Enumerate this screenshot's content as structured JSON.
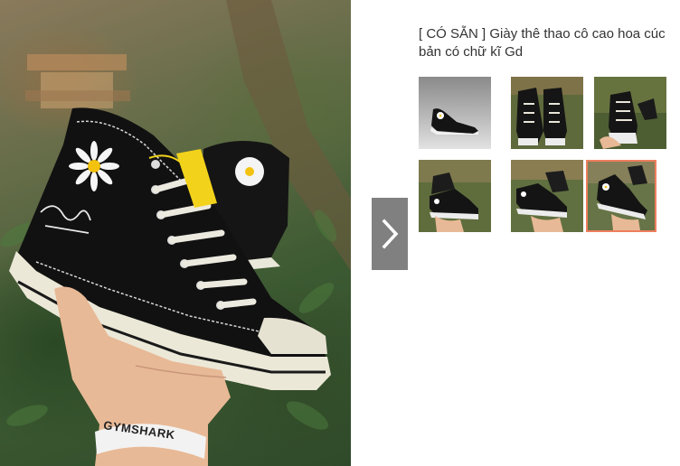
{
  "product": {
    "title": "[ CÓ SẴN ] Giày thê thao cô cao hoa cúc bản có chữ kĩ Gd",
    "main_image": {
      "description_icon": "sneaker-photo",
      "wristband_text": "GYMSHARK"
    }
  },
  "gallery": {
    "next_icon": "chevron-right-icon",
    "thumbnails": [
      {
        "icon": "sneaker-photo",
        "active": false
      },
      {
        "icon": "sneaker-photo",
        "active": false
      },
      {
        "icon": "sneaker-photo",
        "active": false
      },
      {
        "icon": "sneaker-photo",
        "active": false
      },
      {
        "icon": "sneaker-photo",
        "active": false
      },
      {
        "icon": "sneaker-photo",
        "active": true
      }
    ]
  },
  "colors": {
    "accent_border": "#ee7e5e",
    "nav_button": "#808080",
    "title_text": "#333333"
  }
}
